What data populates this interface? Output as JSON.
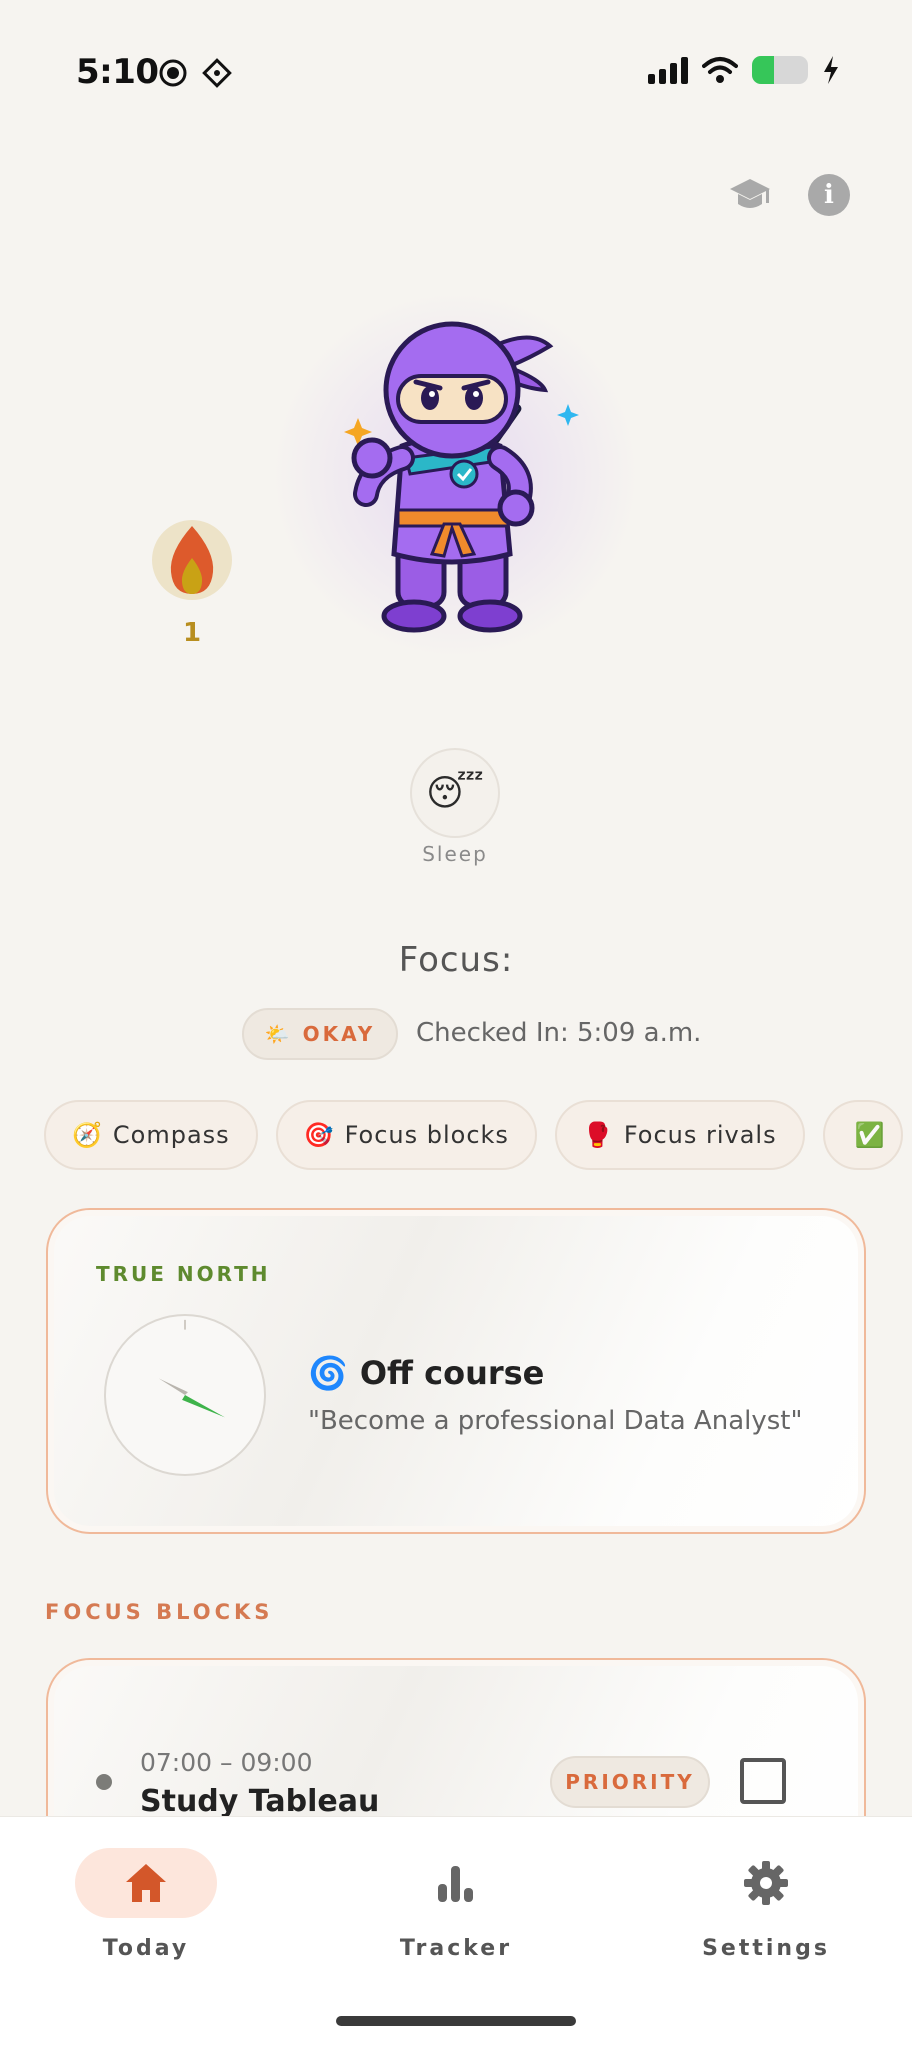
{
  "status_bar": {
    "time": "5:10"
  },
  "header": {
    "learn_icon": "graduation-cap-icon",
    "info_icon": "info-icon",
    "info_glyph": "i"
  },
  "streak": {
    "count": "1",
    "icon": "flame-icon"
  },
  "mood": {
    "emoji": "😴",
    "label": "Sleep"
  },
  "focus": {
    "title": "Focus:",
    "status_emoji": "🌤️",
    "status_label": "OKAY",
    "checked_in": "Checked In: 5:09 a.m."
  },
  "chips": [
    {
      "emoji": "🧭",
      "label": "Compass"
    },
    {
      "emoji": "🎯",
      "label": "Focus blocks"
    },
    {
      "emoji": "🥊",
      "label": "Focus rivals"
    },
    {
      "emoji": "✅",
      "label": ""
    }
  ],
  "true_north": {
    "label": "TRUE NORTH",
    "course_emoji": "🌀",
    "course_status": "Off course",
    "goal": "\"Become a professional Data Analyst\""
  },
  "focus_blocks": {
    "heading": "FOCUS BLOCKS",
    "items": [
      {
        "time": "07:00 – 09:00",
        "title": "Study Tableau",
        "badge": "PRIORITY",
        "checked": false
      }
    ]
  },
  "tabs": [
    {
      "label": "Today",
      "icon": "home-icon",
      "active": true
    },
    {
      "label": "Tracker",
      "icon": "bar-chart-icon",
      "active": false
    },
    {
      "label": "Settings",
      "icon": "gear-icon",
      "active": false
    }
  ],
  "colors": {
    "background": "#f6f4f0",
    "accent": "#d96a3c",
    "true_north_green": "#5e8a2e",
    "card_border": "#f0b99a",
    "active_tab": "#fde6dc"
  }
}
